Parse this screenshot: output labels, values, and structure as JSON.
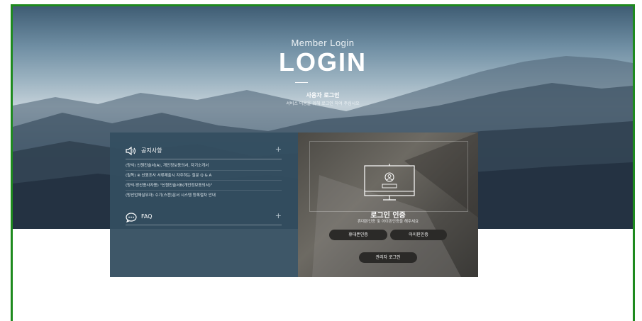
{
  "header": {
    "member_login": "Member Login",
    "title": "LOGIN",
    "user_login": "사용자 로그인",
    "instruction": "서비스 이용을 위해 로그인 하여 주십시오"
  },
  "notices": {
    "title": "공지사항",
    "expand": "+",
    "items": [
      "(양식) 신원진술서(A), 개인정보동의서, 자기소개서",
      "(필독) ※ 신원조사 서류제출시 자주하는 질문 Q & A",
      "(양식-방산종사자용) \"신원진술서B(개인정보동의서)\"",
      "(방산업체실무자) 수기(스캔)문서 시스템 등록절차 안내"
    ]
  },
  "faq": {
    "title": "FAQ",
    "expand": "+"
  },
  "auth": {
    "title": "로그인 인증",
    "subtitle": "휴대폰인증 및 아이핀인증을 해주세요",
    "phone_button": "휴대폰인증",
    "ipin_button": "아이핀인증",
    "admin_button": "관리자 로그인"
  },
  "icons": {
    "notice": "speaker-icon",
    "faq": "chat-bubble-icon",
    "auth": "monitor-user-icon"
  },
  "colors": {
    "frame_border": "#1e8a1e",
    "left_panel": "#344e60",
    "pill": "#2b2a28"
  }
}
